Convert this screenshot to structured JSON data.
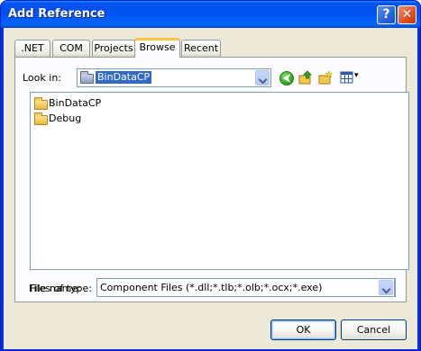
{
  "window": {
    "title": "Add Reference",
    "help_glyph": "?",
    "close_glyph": "✕"
  },
  "tabs": [
    {
      "label": ".NET",
      "active": false
    },
    {
      "label": "COM",
      "active": false
    },
    {
      "label": "Projects",
      "active": false
    },
    {
      "label": "Browse",
      "active": true
    },
    {
      "label": "Recent",
      "active": false
    }
  ],
  "look_in": {
    "label": "Look in:",
    "value": "BinDataCP"
  },
  "toolbar": {
    "back_glyph": "⮜",
    "views_glyph": "▾"
  },
  "files": [
    {
      "name": "BinDataCP",
      "icon": "folder-icon"
    },
    {
      "name": "Debug",
      "icon": "folder-icon"
    }
  ],
  "file_name": {
    "label": "File name:",
    "value": ""
  },
  "file_type": {
    "label": "Files of type:",
    "value": "Component Files (*.dll;*.tlb;*.olb;*.ocx;*.exe)"
  },
  "buttons": {
    "ok": "OK",
    "cancel": "Cancel"
  },
  "colors": {
    "title_bar": "#0054e3",
    "selection": "#316ac5",
    "dialog_bg": "#ece9d8"
  }
}
